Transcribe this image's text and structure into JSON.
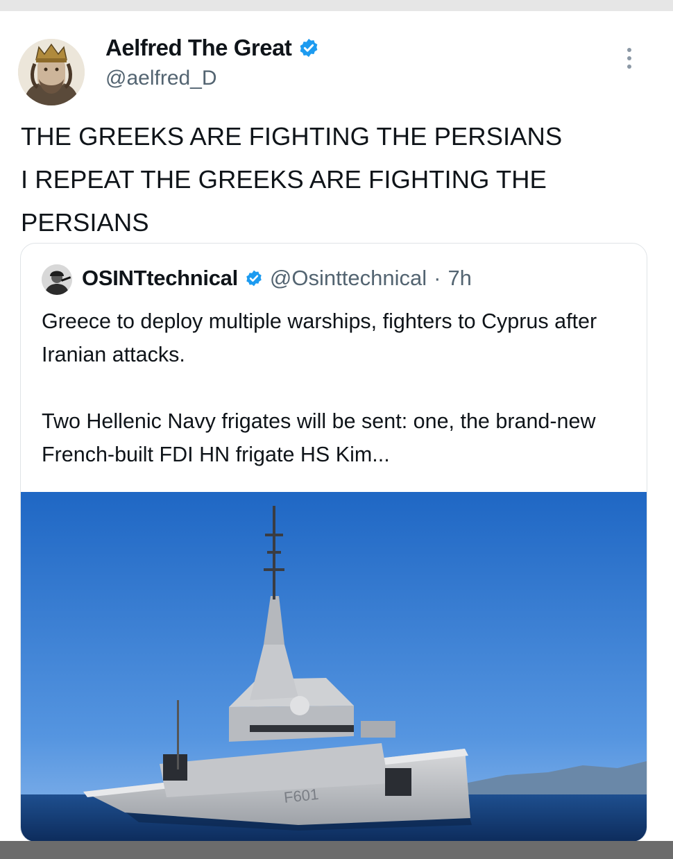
{
  "post": {
    "author": {
      "display_name": "Aelfred The Great",
      "handle": "@aelfred_D",
      "verified": true,
      "avatar_icon": "king-portrait-avatar"
    },
    "text": "THE GREEKS ARE FIGHTING THE PERSIANS\nI REPEAT THE GREEKS ARE FIGHTING THE\nPERSIANS",
    "more_icon": "vertical-ellipsis-icon"
  },
  "quoted_post": {
    "author": {
      "display_name": "OSINTtechnical",
      "handle": "@Osinttechnical",
      "separator": "·",
      "time": "7h",
      "verified": true,
      "avatar_icon": "soldier-avatar"
    },
    "paragraph_1": "Greece to deploy multiple warships, fighters to Cyprus after Iranian attacks.",
    "paragraph_2": "Two Hellenic Navy frigates will be sent: one, the brand-new French-built FDI HN frigate HS Kim...",
    "image": {
      "subject": "grey-frigate-at-sea-photo",
      "hull_marking": "F601"
    }
  },
  "colors": {
    "verified_badge": "#1d9bf0",
    "secondary_text": "#536471",
    "border": "#dfe3e6",
    "sky_top": "#1f67c4",
    "sea": "#123a72"
  }
}
